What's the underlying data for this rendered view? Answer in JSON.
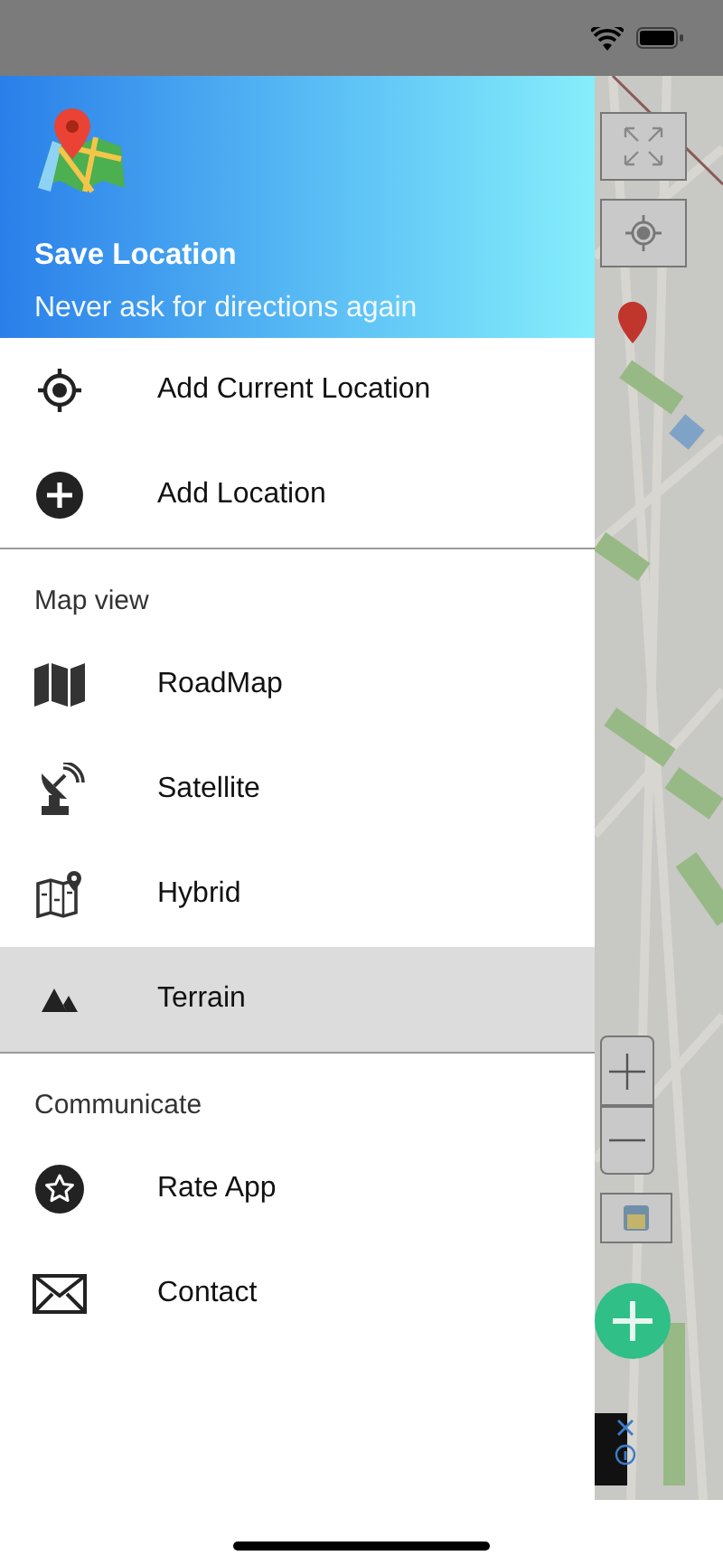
{
  "header": {
    "title": "Save Location",
    "subtitle": "Never ask for directions again"
  },
  "sections": [
    {
      "items": [
        {
          "label": "Add Current Location",
          "selected": false
        },
        {
          "label": "Add Location",
          "selected": false
        }
      ]
    },
    {
      "title": "Map view",
      "items": [
        {
          "label": "RoadMap",
          "selected": false
        },
        {
          "label": "Satellite",
          "selected": false
        },
        {
          "label": "Hybrid",
          "selected": false
        },
        {
          "label": "Terrain",
          "selected": true
        }
      ]
    },
    {
      "title": "Communicate",
      "items": [
        {
          "label": "Rate App",
          "selected": false
        },
        {
          "label": "Contact",
          "selected": false
        }
      ]
    }
  ]
}
